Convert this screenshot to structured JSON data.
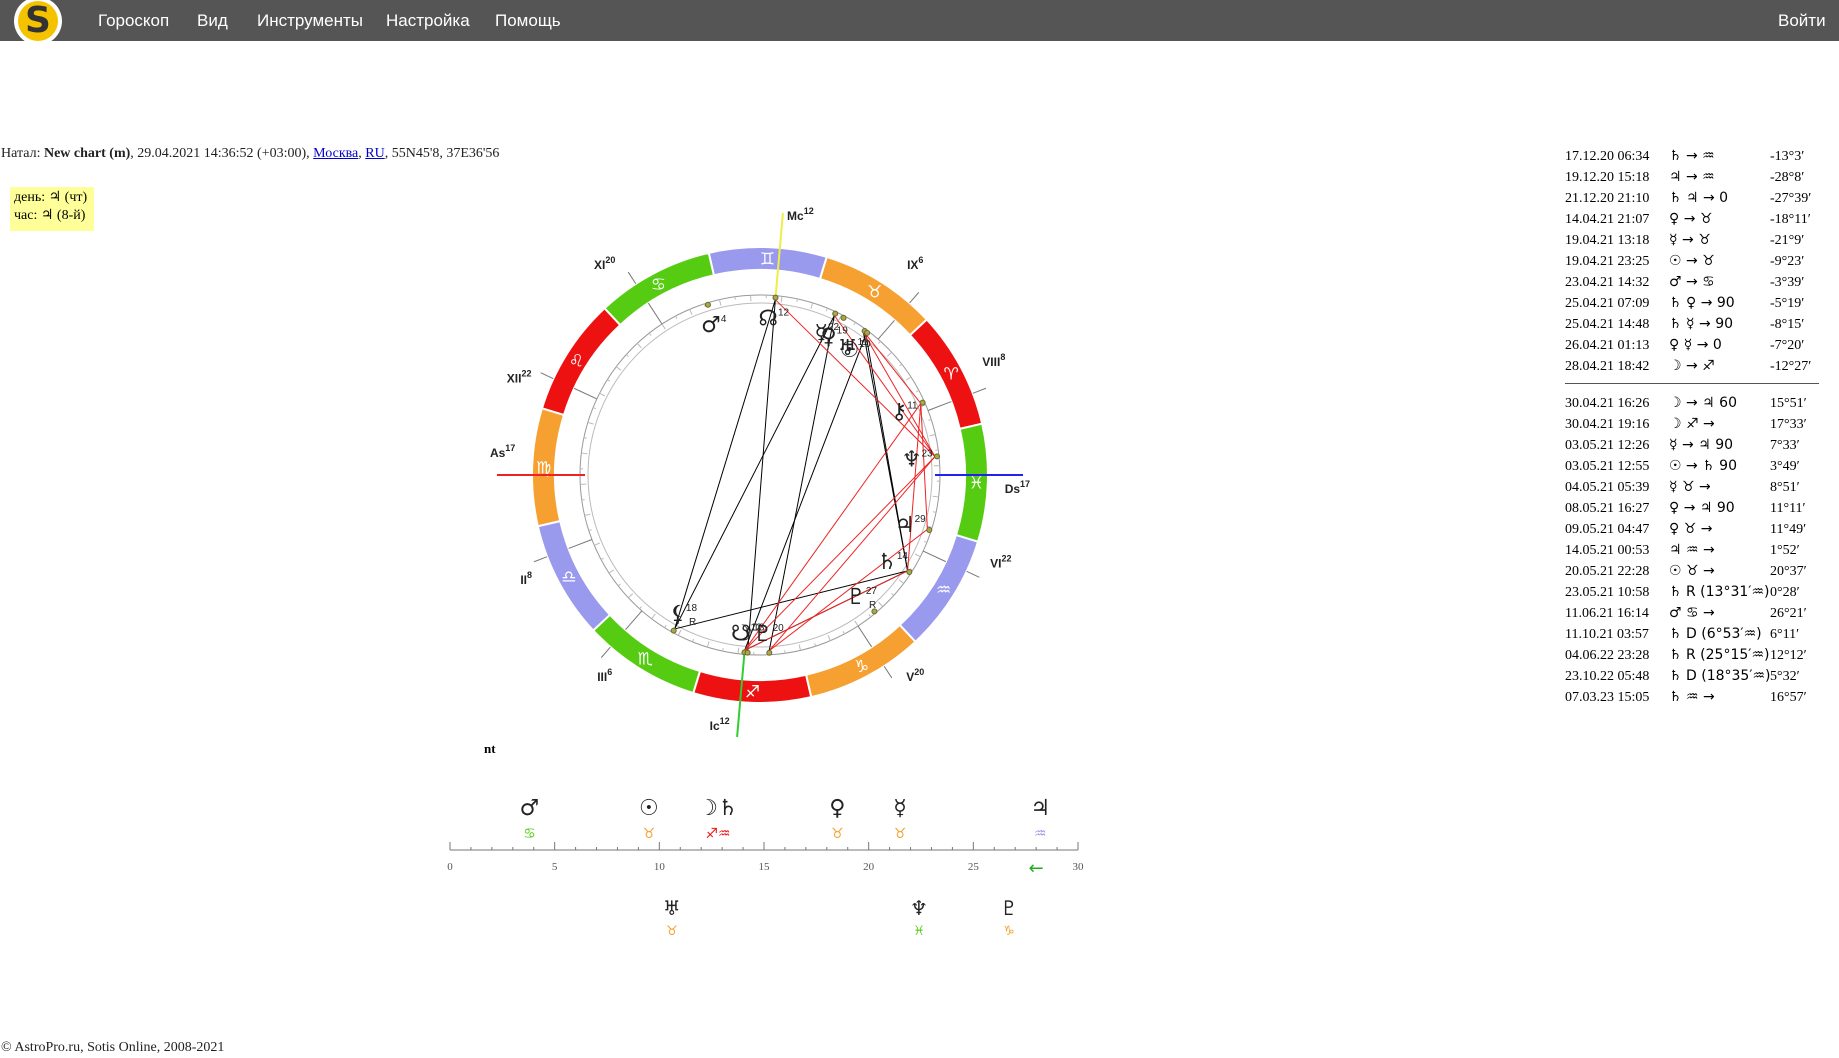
{
  "nav": {
    "logo_letter": "S",
    "menu": [
      "Гороскоп",
      "Вид",
      "Инструменты",
      "Настройка",
      "Помощь"
    ],
    "login": "Войти"
  },
  "header": {
    "prefix": "Натал: ",
    "chart_name": "New chart (m)",
    "datetime": ", 29.04.2021 14:36:52 (+03:00), ",
    "city": "Москва",
    "sep": ", ",
    "country": "RU",
    "coords": ", 55N45'8, 37E36'56"
  },
  "daybox": {
    "day": "день: ♃ (чт)",
    "hour": "час: ♃ (8-й)"
  },
  "chart": {
    "ascendant_longitude": 167,
    "zodiac_colors": {
      "fire": "#ee1111",
      "earth": "#f5a030",
      "air": "#9999ee",
      "water": "#55cc11"
    },
    "sign_glyphs": [
      "♈",
      "♉",
      "♊",
      "♋",
      "♌",
      "♍",
      "♎",
      "♏",
      "♐",
      "♑",
      "♒",
      "♓"
    ],
    "cusps": [
      {
        "label": "As",
        "num": "17",
        "lon": 167
      },
      {
        "label": "II",
        "num": "8",
        "lon": 188
      },
      {
        "label": "III",
        "num": "6",
        "lon": 216
      },
      {
        "label": "Ic",
        "num": "12",
        "lon": 252
      },
      {
        "label": "V",
        "num": "20",
        "lon": 290
      },
      {
        "label": "VI",
        "num": "22",
        "lon": 322
      },
      {
        "label": "Ds",
        "num": "17",
        "lon": 347
      },
      {
        "label": "VIII",
        "num": "8",
        "lon": 8
      },
      {
        "label": "IX",
        "num": "6",
        "lon": 36
      },
      {
        "label": "Mc",
        "num": "12",
        "lon": 72
      },
      {
        "label": "XI",
        "num": "20",
        "lon": 110
      },
      {
        "label": "XII",
        "num": "22",
        "lon": 142
      }
    ],
    "planets": [
      {
        "glyph": "♂",
        "deg": "4",
        "r": "",
        "lon": 94
      },
      {
        "glyph": "☊",
        "deg": "12",
        "r": "",
        "lon": 72
      },
      {
        "glyph": "☿",
        "deg": "22",
        "r": "",
        "lon": 52
      },
      {
        "glyph": "♀",
        "deg": "19",
        "r": "",
        "lon": 49
      },
      {
        "glyph": "♅",
        "deg": "11",
        "r": "",
        "lon": 41
      },
      {
        "glyph": "☉",
        "deg": "10",
        "r": "",
        "lon": 40
      },
      {
        "glyph": "⚷",
        "deg": "11",
        "r": "",
        "lon": 11
      },
      {
        "glyph": "♆",
        "deg": "23",
        "r": "",
        "lon": 353
      },
      {
        "glyph": "♃",
        "deg": "29",
        "r": "",
        "lon": 329
      },
      {
        "glyph": "♄",
        "deg": "14",
        "r": "",
        "lon": 314
      },
      {
        "glyph": "♇",
        "deg": "27",
        "r": "R",
        "lon": 297
      },
      {
        "glyph": "♇",
        "deg": "20",
        "r": "",
        "lon": 260
      },
      {
        "glyph": "☋",
        "deg": "12",
        "r": "",
        "lon": 252
      },
      {
        "glyph": "☽",
        "deg": "13",
        "r": "",
        "lon": 253
      },
      {
        "glyph": "⚸",
        "deg": "18",
        "r": "R",
        "lon": 228
      }
    ],
    "nt_label": "nt"
  },
  "scale": {
    "ticks": [
      "0",
      "5",
      "10",
      "15",
      "20",
      "25",
      "30"
    ],
    "arrow": "←",
    "top": [
      {
        "glyph": "♂",
        "sign": "♋",
        "signColor": "#55cc11",
        "pos": 3.8
      },
      {
        "glyph": "☉",
        "sign": "♉",
        "signColor": "#f5a030",
        "pos": 9.5
      },
      {
        "glyph": "☽♄",
        "sign": "♐♒",
        "signColor": "#ee1111",
        "pos": 12.8
      },
      {
        "glyph": "♀",
        "sign": "♉",
        "signColor": "#f5a030",
        "pos": 18.5
      },
      {
        "glyph": "☿",
        "sign": "♉",
        "signColor": "#f5a030",
        "pos": 21.5
      },
      {
        "glyph": "♃",
        "sign": "♒",
        "signColor": "#9999ee",
        "pos": 28.2
      }
    ],
    "bottom": [
      {
        "glyph": "♅",
        "sign": "♉",
        "signColor": "#f5a030",
        "pos": 10.6
      },
      {
        "glyph": "♆",
        "sign": "♓",
        "signColor": "#55cc11",
        "pos": 22.4
      },
      {
        "glyph": "♇",
        "sign": "♑",
        "signColor": "#f5a030",
        "pos": 26.7
      }
    ]
  },
  "events": {
    "past": [
      {
        "date": "17.12.20 06:34",
        "phrase": "♄ → ♒",
        "value": "-13°3′"
      },
      {
        "date": "19.12.20 15:18",
        "phrase": "♃ → ♒",
        "value": "-28°8′"
      },
      {
        "date": "21.12.20 21:10",
        "phrase": "♄ ♃ → 0",
        "value": "-27°39′"
      },
      {
        "date": "14.04.21 21:07",
        "phrase": "♀ → ♉",
        "value": "-18°11′"
      },
      {
        "date": "19.04.21 13:18",
        "phrase": "☿ → ♉",
        "value": "-21°9′"
      },
      {
        "date": "19.04.21 23:25",
        "phrase": "☉ → ♉",
        "value": "-9°23′"
      },
      {
        "date": "23.04.21 14:32",
        "phrase": "♂ → ♋",
        "value": "-3°39′"
      },
      {
        "date": "25.04.21 07:09",
        "phrase": "♄ ♀ → 90",
        "value": "-5°19′"
      },
      {
        "date": "25.04.21 14:48",
        "phrase": "♄ ☿ → 90",
        "value": "-8°15′"
      },
      {
        "date": "26.04.21 01:13",
        "phrase": "♀ ☿ → 0",
        "value": "-7°20′"
      },
      {
        "date": "28.04.21 18:42",
        "phrase": "☽ → ♐",
        "value": "-12°27′"
      }
    ],
    "future": [
      {
        "date": "30.04.21 16:26",
        "phrase": "☽ → ♃ 60",
        "value": "15°51′"
      },
      {
        "date": "30.04.21 19:16",
        "phrase": "☽ ♐ →",
        "value": "17°33′"
      },
      {
        "date": "03.05.21 12:26",
        "phrase": "☿ → ♃ 90",
        "value": "7°33′"
      },
      {
        "date": "03.05.21 12:55",
        "phrase": "☉ → ♄ 90",
        "value": "3°49′"
      },
      {
        "date": "04.05.21 05:39",
        "phrase": "☿ ♉ →",
        "value": "8°51′"
      },
      {
        "date": "08.05.21 16:27",
        "phrase": "♀ → ♃ 90",
        "value": "11°11′"
      },
      {
        "date": "09.05.21 04:47",
        "phrase": "♀ ♉ →",
        "value": "11°49′"
      },
      {
        "date": "14.05.21 00:53",
        "phrase": "♃ ♒ →",
        "value": "1°52′"
      },
      {
        "date": "20.05.21 22:28",
        "phrase": "☉ ♉ →",
        "value": "20°37′"
      },
      {
        "date": "23.05.21 10:58",
        "phrase": "♄ R (13°31′♒)",
        "value": "0°28′"
      },
      {
        "date": "11.06.21 16:14",
        "phrase": "♂ ♋ →",
        "value": "26°21′"
      },
      {
        "date": "11.10.21 03:57",
        "phrase": "♄ D (6°53′♒)",
        "value": "6°11′"
      },
      {
        "date": "04.06.22 23:28",
        "phrase": "♄ R (25°15′♒)",
        "value": "12°12′"
      },
      {
        "date": "23.10.22 05:48",
        "phrase": "♄ D (18°35′♒)",
        "value": "5°32′"
      },
      {
        "date": "07.03.23 15:05",
        "phrase": "♄ ♒ →",
        "value": "16°57′"
      }
    ]
  },
  "footer": "© AstroPro.ru, Sotis Online, 2008-2021"
}
